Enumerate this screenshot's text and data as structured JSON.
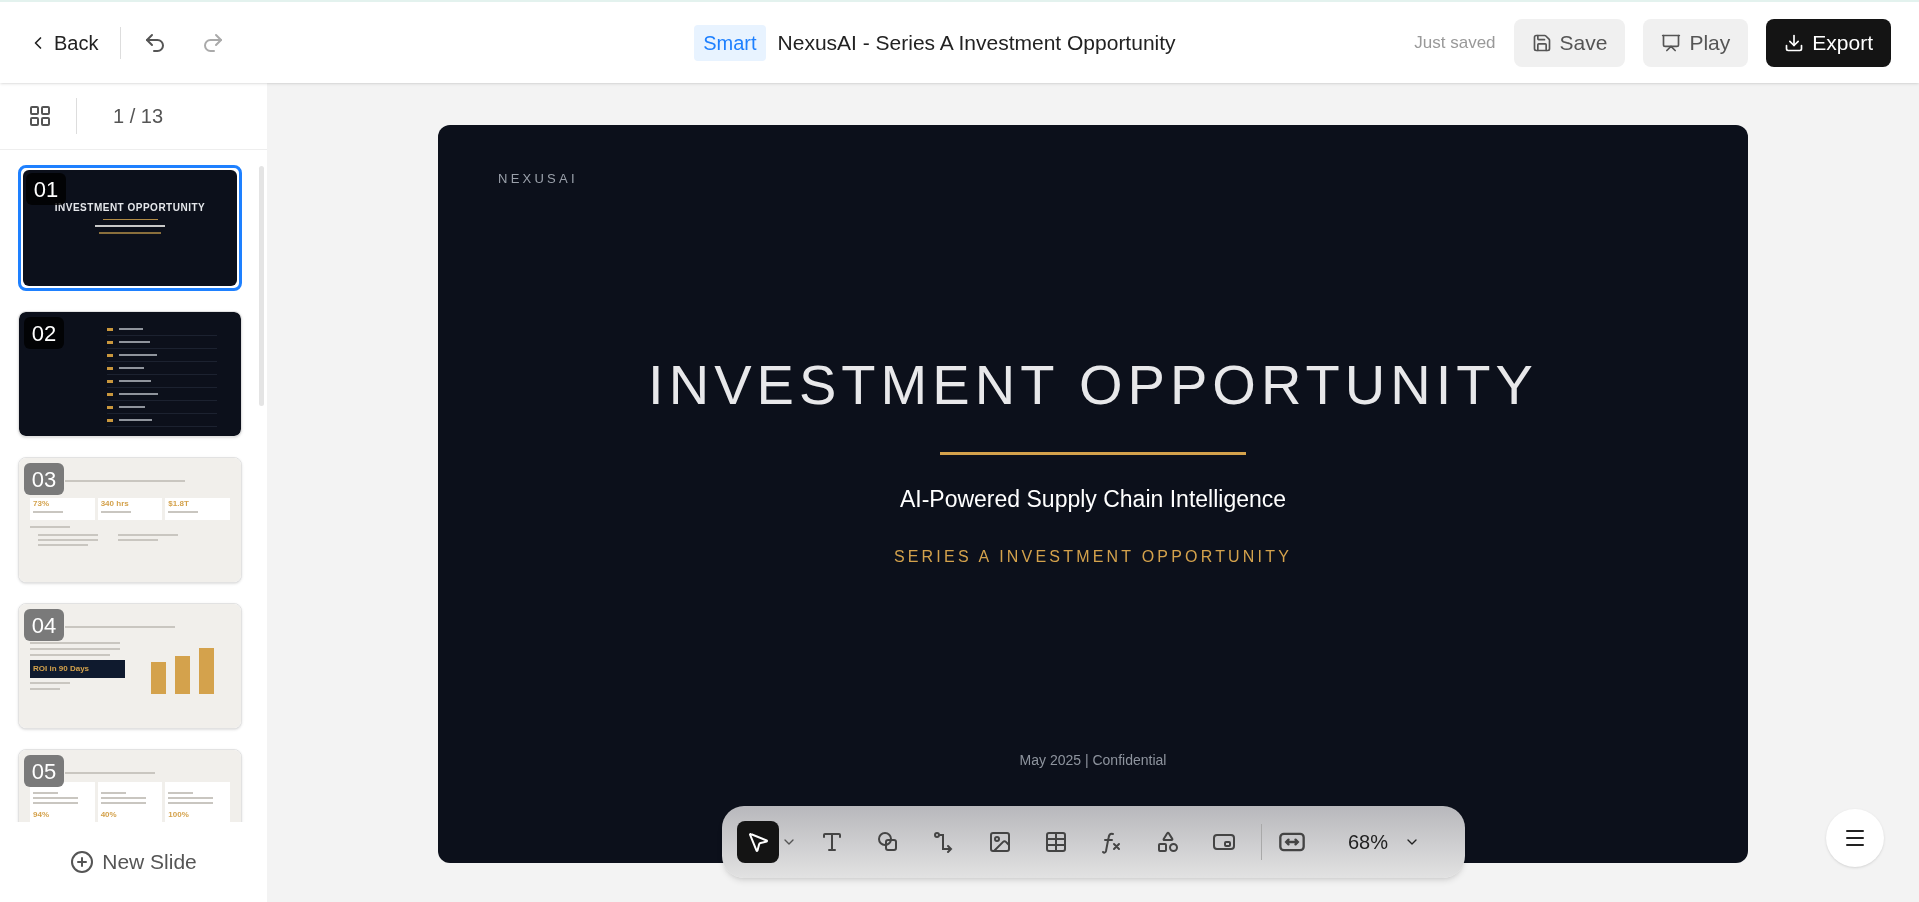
{
  "topbar": {
    "back": "Back",
    "badge": "Smart",
    "title": "NexusAI - Series A Investment Opportunity",
    "status": "Just saved",
    "buttons": [
      {
        "kind": "save",
        "label": "Save"
      },
      {
        "kind": "play",
        "label": "Play"
      },
      {
        "kind": "export",
        "label": "Export"
      }
    ]
  },
  "sidebar": {
    "page": "1 / 13",
    "new_slide": "New Slide",
    "slides": [
      {
        "kind": "title",
        "number": "01",
        "selected": true,
        "title": "INVESTMENT OPPORTUNITY"
      },
      {
        "kind": "contents",
        "number": "02",
        "selected": false
      },
      {
        "kind": "stats",
        "number": "03",
        "selected": false,
        "stats": [
          "73%",
          "340 hrs",
          "$1.8T"
        ]
      },
      {
        "kind": "chart",
        "number": "04",
        "selected": false,
        "callout": "ROI in 90 Days"
      },
      {
        "kind": "modules",
        "number": "05",
        "selected": false,
        "values": [
          "94%",
          "40%",
          "100%"
        ]
      }
    ]
  },
  "slide": {
    "brand": "NEXUSAI",
    "title": "INVESTMENT OPPORTUNITY",
    "subtitle": "AI-Powered Supply Chain Intelligence",
    "tagline": "SERIES A INVESTMENT OPPORTUNITY",
    "footer": "May 2025 | Confidential"
  },
  "toolbar": {
    "tools": [
      {
        "kind": "select",
        "selected": true
      },
      {
        "kind": "text",
        "selected": false
      },
      {
        "kind": "shape",
        "selected": false
      },
      {
        "kind": "connector",
        "selected": false
      },
      {
        "kind": "image",
        "selected": false
      },
      {
        "kind": "table",
        "selected": false
      },
      {
        "kind": "formula",
        "selected": false
      },
      {
        "kind": "elements",
        "selected": false
      },
      {
        "kind": "embed",
        "selected": false
      }
    ],
    "zoom": "68%"
  }
}
